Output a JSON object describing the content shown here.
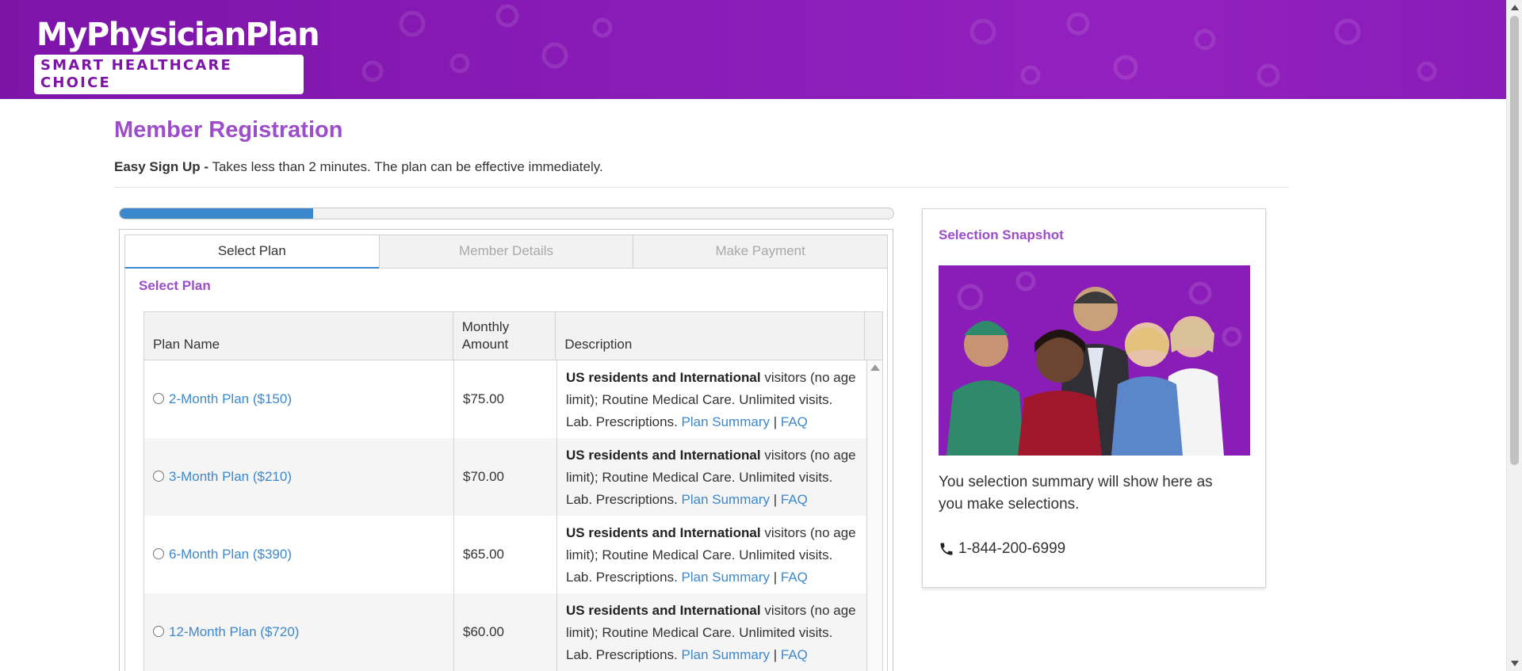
{
  "header": {
    "logo_title": "MyPhysicianPlan",
    "logo_tagline": "SMART HEALTHCARE CHOICE",
    "brand_color": "#7d14a8"
  },
  "page": {
    "title": "Member Registration",
    "subtitle_bold": "Easy Sign Up -",
    "subtitle_text": " Takes less than 2 minutes. The plan can be effective immediately.",
    "progress_fraction": 0.25
  },
  "wizard": {
    "tabs": [
      {
        "label": "Select Plan",
        "active": true
      },
      {
        "label": "Member Details",
        "active": false
      },
      {
        "label": "Make Payment",
        "active": false
      }
    ],
    "section_title": "Select Plan",
    "table": {
      "headers": {
        "name": "Plan Name",
        "amount": "Monthly Amount",
        "description": "Description"
      },
      "rows": [
        {
          "name": "2-Month Plan ($150)",
          "amount": "$75.00",
          "desc_bold": "US residents and International",
          "desc_text": " visitors (no age limit); Routine Medical Care. Unlimited visits. Lab. Prescriptions. ",
          "summary_link": "Plan Summary",
          "separator": " | ",
          "faq_link": "FAQ"
        },
        {
          "name": "3-Month Plan ($210)",
          "amount": "$70.00",
          "desc_bold": "US residents and International",
          "desc_text": " visitors (no age limit); Routine Medical Care. Unlimited visits. Lab. Prescriptions. ",
          "summary_link": "Plan Summary",
          "separator": " | ",
          "faq_link": "FAQ"
        },
        {
          "name": "6-Month Plan ($390)",
          "amount": "$65.00",
          "desc_bold": "US residents and International",
          "desc_text": " visitors (no age limit); Routine Medical Care. Unlimited visits. Lab. Prescriptions. ",
          "summary_link": "Plan Summary",
          "separator": " | ",
          "faq_link": "FAQ"
        },
        {
          "name": "12-Month Plan ($720)",
          "amount": "$60.00",
          "desc_bold": "US residents and International",
          "desc_text": " visitors (no age limit); Routine Medical Care. Unlimited visits. Lab. Prescriptions. ",
          "summary_link": "Plan Summary",
          "separator": " | ",
          "faq_link": "FAQ"
        }
      ]
    }
  },
  "snapshot": {
    "title": "Selection Snapshot",
    "summary_text": "You selection summary will show here as you make selections.",
    "phone": "1-844-200-6999",
    "phone_icon": "phone-icon"
  },
  "colors": {
    "accent_purple": "#9b4dca",
    "link_blue": "#3c88cc",
    "progress_blue": "#3c88cc"
  }
}
